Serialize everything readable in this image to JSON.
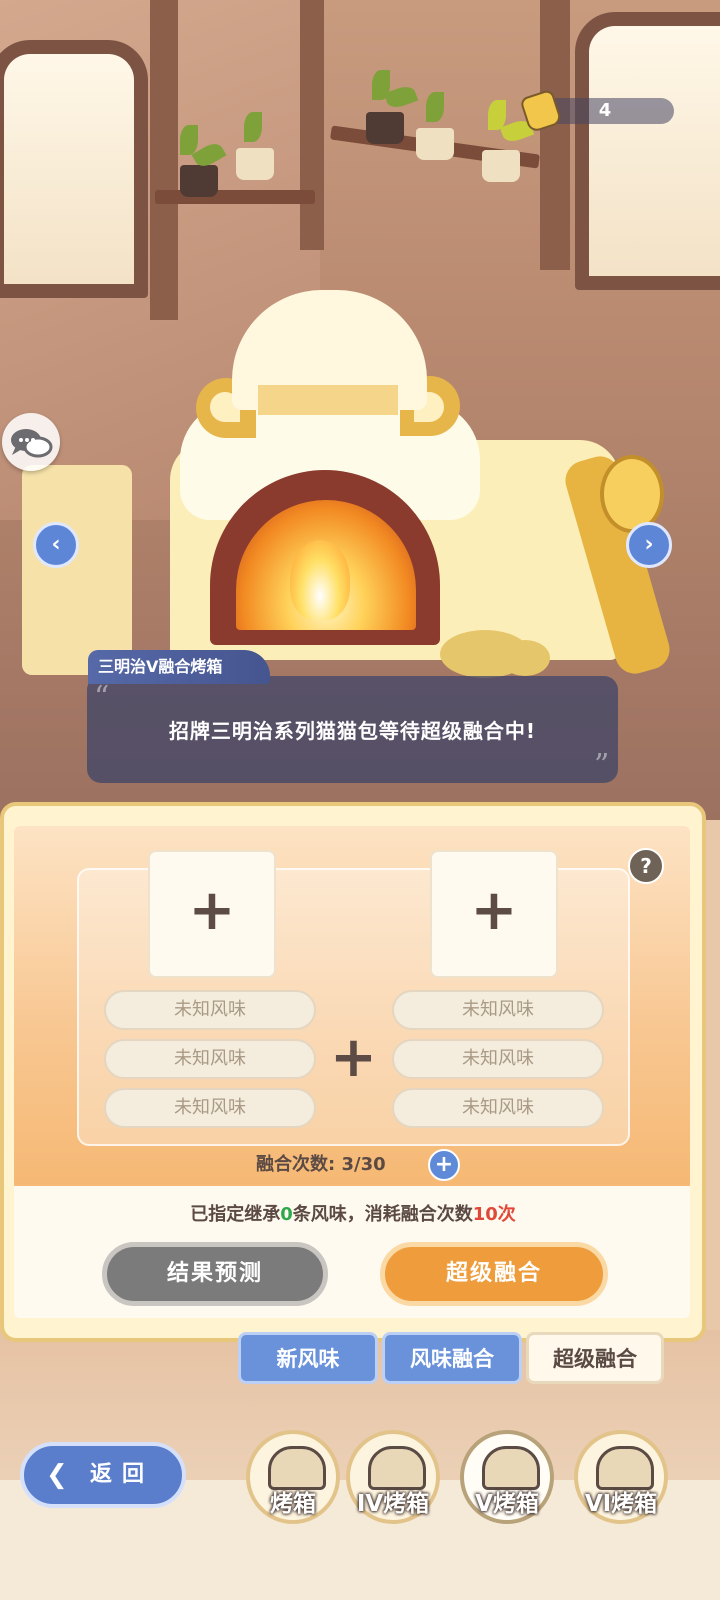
{
  "hud": {
    "coin_count": "4",
    "coin_icon": "ticket-icon",
    "chat_icon": "chat-bubbles-icon"
  },
  "oven": {
    "name": "三明治V融合烤箱",
    "message": "招牌三明治系列猫猫包等待超级融合中!",
    "prev_icon": "chevron-left-icon",
    "next_icon": "chevron-right-icon"
  },
  "fusion": {
    "slot_left_symbol": "+",
    "slot_right_symbol": "+",
    "center_symbol": "+",
    "help_symbol": "?",
    "left_flavors": [
      "未知风味",
      "未知风味",
      "未知风味"
    ],
    "right_flavors": [
      "未知风味",
      "未知风味",
      "未知风味"
    ],
    "count_label": "融合次数:",
    "count_value": "3/30",
    "count_add_symbol": "+",
    "info_prefix": "已指定继承",
    "info_inherit_count": "0",
    "info_middle": "条风味，消耗融合次数",
    "info_cost": "10次",
    "predict_button": "结果预测",
    "super_button": "超级融合"
  },
  "tabs": [
    {
      "label": "新风味",
      "active": false
    },
    {
      "label": "风味融合",
      "active": false
    },
    {
      "label": "超级融合",
      "active": true
    }
  ],
  "bottom_nav": {
    "back_label": "返回",
    "oven_tabs": [
      {
        "label": "烤箱",
        "active": false
      },
      {
        "label": "IV烤箱",
        "active": false
      },
      {
        "label": "V烤箱",
        "active": true
      },
      {
        "label": "VI烤箱",
        "active": false
      }
    ]
  },
  "colors": {
    "accent_blue": "#6a92db",
    "accent_orange": "#ef9d3c",
    "inherit_green": "#2ea84a",
    "cost_red": "#e0493a"
  }
}
